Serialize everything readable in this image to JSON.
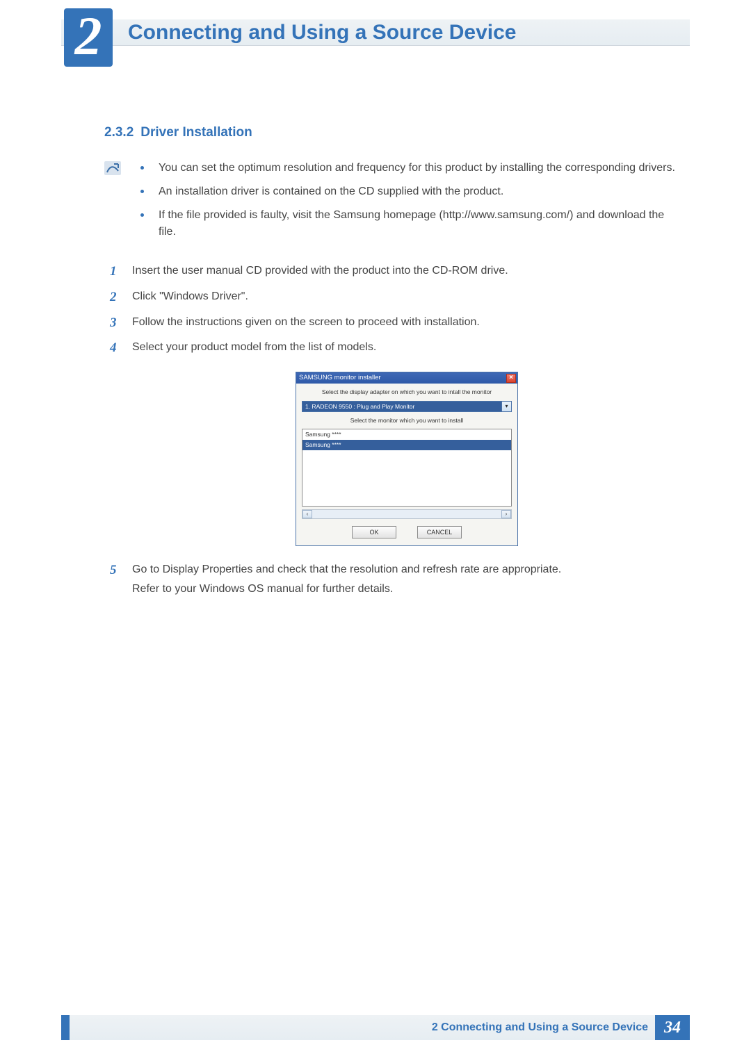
{
  "chapter": {
    "number": "2",
    "title": "Connecting and Using a Source Device"
  },
  "section": {
    "number": "2.3.2",
    "title": "Driver Installation"
  },
  "notes": [
    "You can set the optimum resolution and frequency for this product by installing the corresponding drivers.",
    "An installation driver is contained on the CD supplied with the product.",
    "If the file provided is faulty, visit the Samsung homepage (http://www.samsung.com/) and download the file."
  ],
  "steps": [
    {
      "num": "1",
      "text": "Insert the user manual CD provided with the product into the CD-ROM drive."
    },
    {
      "num": "2",
      "text": "Click \"Windows Driver\"."
    },
    {
      "num": "3",
      "text": "Follow the instructions given on the screen to proceed with installation."
    },
    {
      "num": "4",
      "text": "Select your product model from the list of models."
    },
    {
      "num": "5",
      "text": "Go to Display Properties and check that the resolution and refresh rate are appropriate.",
      "extra": "Refer to your Windows OS manual for further details."
    }
  ],
  "dialog": {
    "title": "SAMSUNG monitor installer",
    "instr1": "Select the display adapter on which you want to intall the monitor",
    "adapter_selected": "1. RADEON 9550 : Plug and Play Monitor",
    "instr2": "Select the monitor which you want to install",
    "list_items": [
      "Samsung ****",
      "Samsung ****"
    ],
    "ok": "OK",
    "cancel": "CANCEL",
    "close": "×"
  },
  "footer": {
    "text": "2 Connecting and Using a Source Device",
    "page": "34"
  }
}
